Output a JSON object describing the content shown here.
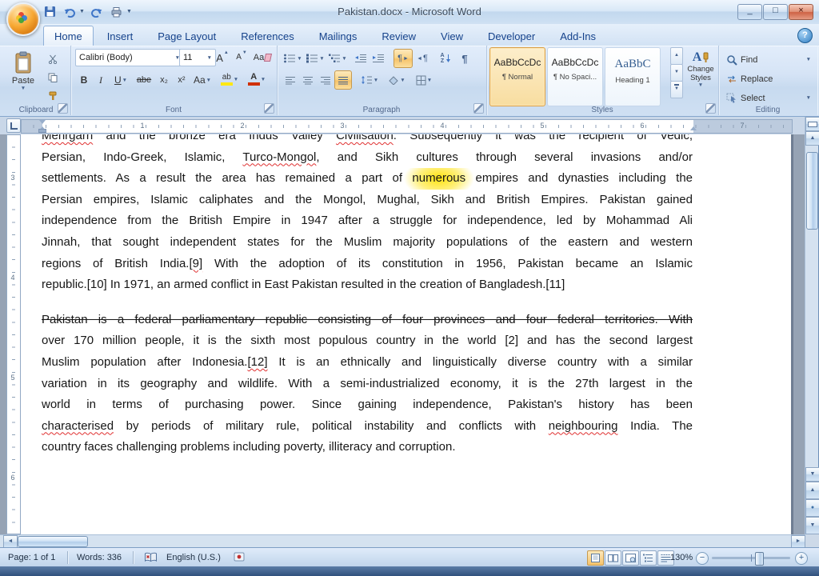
{
  "titlebar": {
    "title": "Pakistan.docx - Microsoft Word"
  },
  "icons": {
    "dropdown": "▼",
    "tri_up": "▲",
    "tri_down": "▼",
    "tri_left": "◄",
    "tri_right": "►",
    "minimize": "_",
    "maximize": "□",
    "close": "×",
    "help": "?",
    "pilcrow": "¶",
    "browse_ball": "●",
    "zoom_out": "−",
    "zoom_in": "+",
    "change_styles_icon": "A"
  },
  "tabs": [
    {
      "label": "Home",
      "active": true
    },
    {
      "label": "Insert"
    },
    {
      "label": "Page Layout"
    },
    {
      "label": "References"
    },
    {
      "label": "Mailings"
    },
    {
      "label": "Review"
    },
    {
      "label": "View"
    },
    {
      "label": "Developer"
    },
    {
      "label": "Add-Ins"
    }
  ],
  "ribbon": {
    "clipboard": {
      "group_label": "Clipboard",
      "paste": "Paste"
    },
    "font": {
      "group_label": "Font",
      "name_value": "Calibri (Body)",
      "size_value": "11",
      "bold": "B",
      "italic": "I",
      "underline": "U",
      "strikethrough": "abe",
      "subscript": "x₂",
      "superscript": "x²",
      "change_case": "Aa",
      "highlight": "ab",
      "font_color": "A",
      "grow_font": "A",
      "shrink_font": "A",
      "clear_format": "Aa"
    },
    "paragraph": {
      "group_label": "Paragraph",
      "sort_a": "A",
      "sort_z": "Z"
    },
    "styles": {
      "group_label": "Styles",
      "gallery": [
        {
          "preview": "AaBbCcDc",
          "label": "¶ Normal",
          "selected": true,
          "heading": false
        },
        {
          "preview": "AaBbCcDc",
          "label": "¶ No Spaci...",
          "selected": false,
          "heading": false
        },
        {
          "preview": "AaBbC",
          "label": "Heading 1",
          "selected": false,
          "heading": true
        }
      ],
      "change_styles_line1": "Change",
      "change_styles_line2": "Styles"
    },
    "editing": {
      "group_label": "Editing",
      "find": "Find",
      "replace": "Replace",
      "select": "Select"
    }
  },
  "ruler": {
    "horizontal_numbers": [
      "1",
      "2",
      "3",
      "4",
      "5",
      "6",
      "7"
    ],
    "vertical_numbers": [
      "3",
      "4",
      "5",
      "6"
    ]
  },
  "document": {
    "paragraphs": [
      {
        "lines": [
          {
            "runs": [
              {
                "t": "Mehrgarh",
                "spell": true
              },
              {
                "t": " and the bronze era Indus Valley "
              },
              {
                "t": "Civilisation",
                "spell": true
              },
              {
                "t": ". Subsequently it was the recipient of Vedic,"
              }
            ]
          },
          {
            "runs": [
              {
                "t": "Persian, Indo-Greek, Islamic, "
              },
              {
                "t": "Turco-Mongol",
                "spell": true
              },
              {
                "t": ", and Sikh cultures through several invasions and/or"
              }
            ]
          },
          {
            "runs": [
              {
                "t": "settlements. As a result the area has remained a part of "
              },
              {
                "t": "numerous",
                "halo": true
              },
              {
                "t": " empires and dynasties including the"
              }
            ]
          },
          {
            "runs": [
              {
                "t": "Persian empires, Islamic caliphates and the Mongol, Mughal, Sikh and British Empires. Pakistan gained"
              }
            ]
          },
          {
            "runs": [
              {
                "t": "independence from the British Empire in 1947 after a struggle for independence, led by Mohammad Ali"
              }
            ]
          },
          {
            "runs": [
              {
                "t": "Jinnah, that sought independent states for the Muslim majority populations of the eastern and western"
              }
            ]
          },
          {
            "runs": [
              {
                "t": "regions of British India."
              },
              {
                "t": "[9]",
                "spell": true
              },
              {
                "t": " With the adoption of its constitution in 1956, Pakistan became an Islamic"
              }
            ]
          },
          {
            "runs": [
              {
                "t": "republic.[10] In 1971, an armed conflict in East Pakistan resulted in the creation of Bangladesh.[11]"
              }
            ],
            "last": true
          }
        ]
      },
      {
        "lines": [
          {
            "runs": [
              {
                "t": "Pakistan is a federal parliamentary republic consisting of four provinces and four federal territories. With",
                "strike": true
              }
            ]
          },
          {
            "runs": [
              {
                "t": "over 170 million people, it is the sixth most populous country in the world [2] and has the second largest"
              }
            ]
          },
          {
            "runs": [
              {
                "t": "Muslim population after Indonesia."
              },
              {
                "t": "[12]",
                "spell": true
              },
              {
                "t": " It is an ethnically and linguistically diverse country with a similar"
              }
            ]
          },
          {
            "runs": [
              {
                "t": "variation in its geography and wildlife. With a semi-industrialized economy, it is the 27th largest in the"
              }
            ]
          },
          {
            "runs": [
              {
                "t": "world in terms of purchasing power. Since gaining independence, Pakistan's history has been"
              }
            ]
          },
          {
            "runs": [
              {
                "t": "characterised",
                "spell": true
              },
              {
                "t": " by periods of military rule, political instability and conflicts with "
              },
              {
                "t": "neighbouring",
                "spell": true
              },
              {
                "t": " India. The"
              }
            ]
          },
          {
            "runs": [
              {
                "t": "country faces challenging problems including poverty, illiteracy and corruption."
              }
            ],
            "last": true
          }
        ]
      }
    ]
  },
  "statusbar": {
    "page": "Page: 1 of 1",
    "words": "Words: 336",
    "language": "English (U.S.)",
    "zoom": "130%"
  },
  "colors": {
    "active_button": "#f5c36b",
    "spell_squiggle": "#e03030",
    "cursor_halo": "#ffe100",
    "highlight_swatch": "#ffe814",
    "font_color_swatch": "#d03000",
    "app_background": "#96a3b4"
  }
}
